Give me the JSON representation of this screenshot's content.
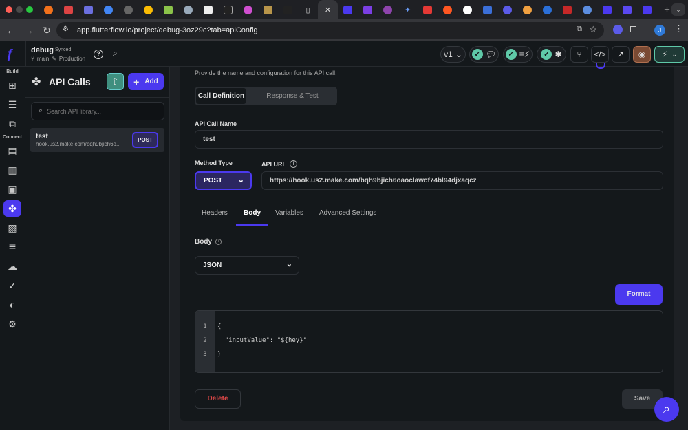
{
  "browser": {
    "url": "app.flutterflow.io/project/debug-3oz29c?tab=apiConfig",
    "profile_initial": "J",
    "new_tab": "+"
  },
  "header": {
    "project": "debug",
    "sync_status": "Synced",
    "branch": "main",
    "environment": "Production",
    "version": "v1",
    "accent": "#4b39ef"
  },
  "rail": {
    "build_label": "Build",
    "connect_label": "Connect"
  },
  "list": {
    "title": "API Calls",
    "add_label": "Add",
    "search_placeholder": "Search API library...",
    "items": [
      {
        "name": "test",
        "url": "hook.us2.make.com/bqh9bjich6o...",
        "method": "POST"
      }
    ]
  },
  "main": {
    "subtitle": "Provide the name and configuration for this API call.",
    "segments": [
      "Call Definition",
      "Response & Test"
    ],
    "name_label": "API Call Name",
    "name_value": "test",
    "method_label": "Method Type",
    "method_value": "POST",
    "url_label": "API URL",
    "url_value": "https://hook.us2.make.com/bqh9bjich6oaoclawcf74bl94djxaqcz",
    "tabs": [
      "Headers",
      "Body",
      "Variables",
      "Advanced Settings"
    ],
    "active_tab": "Body",
    "body_label": "Body",
    "body_type": "JSON",
    "format_label": "Format",
    "code": [
      {
        "n": "1",
        "t": "{"
      },
      {
        "n": "2",
        "t": "  \"inputValue\": \"${hey}\""
      },
      {
        "n": "3",
        "t": "}"
      }
    ],
    "delete_label": "Delete",
    "save_label": "Save"
  }
}
